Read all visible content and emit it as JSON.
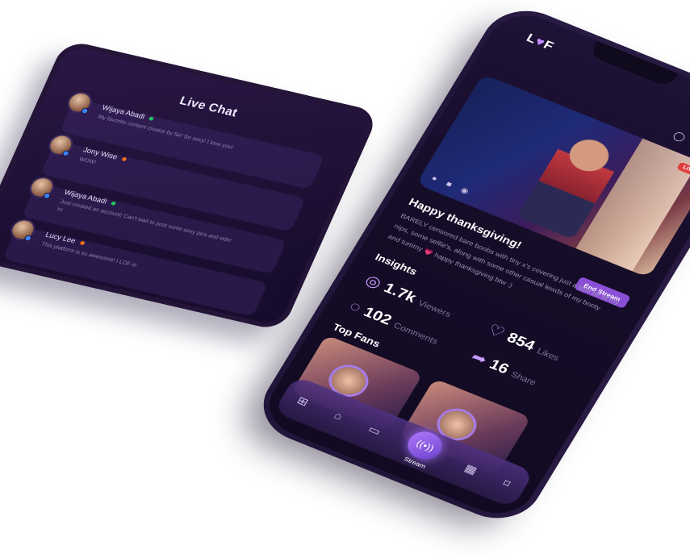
{
  "chat": {
    "title": "Live Chat",
    "messages": [
      {
        "name": "Wijaya Abadi",
        "text": "My favorite content creator by far! So sexy! I love you!",
        "dot": "#22c55e"
      },
      {
        "name": "Jony Wise",
        "text": "WOW!",
        "dot": "#f97316"
      },
      {
        "name": "Wijaya Abadi",
        "text": "Just created an account! Can't wait to post some sexy pics and vids! xx",
        "dot": "#22c55e"
      },
      {
        "name": "Lucy Lee",
        "text": "This platform is so awesome! I LOF it!",
        "dot": "#f97316"
      }
    ]
  },
  "phone": {
    "logo_left": "L",
    "logo_heart": "♥",
    "logo_right": "F",
    "live_badge": "LIVE",
    "stream_title": "Happy thanksgiving!",
    "description": "BARELY censored bare boobs with tiny x's covering just a little bit of my nips, some selfie's, along with some other casual lewds of my booty and tummy 💗 happy thanksgiving btw :)",
    "end_stream": "End Stream",
    "insights_title": "Insights",
    "stats": {
      "viewers": {
        "value": "1.7k",
        "label": "Viewers"
      },
      "likes": {
        "value": "854",
        "label": "Likes"
      },
      "comments": {
        "value": "102",
        "label": "Comments"
      },
      "share": {
        "value": "16",
        "label": "Share"
      }
    },
    "top_fans_title": "Top Fans",
    "tabbar": {
      "stream_label": "Stream"
    }
  }
}
